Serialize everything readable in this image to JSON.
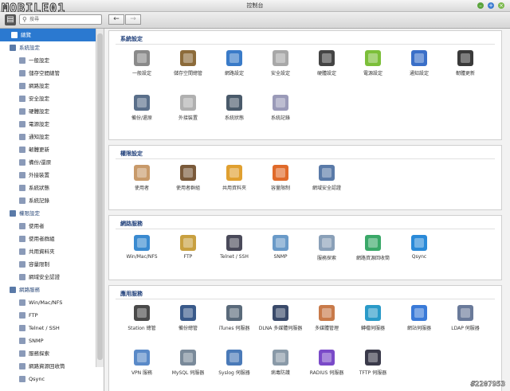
{
  "window": {
    "title": "控制台",
    "logo": "MOBILE01",
    "watermark": "#2207953"
  },
  "toolbar": {
    "search_placeholder": "搜尋",
    "back": "←",
    "forward": "→",
    "menu": "▤"
  },
  "colors": {
    "accent": "#2b79d0",
    "section": "#1f3f7a"
  },
  "sidebar": {
    "overview": "總覽",
    "sections": [
      {
        "label": "系統設定",
        "icon": "gear-icon",
        "items": [
          "一般設定",
          "儲存空間總管",
          "網路設定",
          "安全設定",
          "硬體設定",
          "電源設定",
          "通知設定",
          "韌體更新",
          "備份/還原",
          "外接裝置",
          "系統狀態",
          "系統記錄"
        ]
      },
      {
        "label": "權限設定",
        "icon": "user-icon",
        "items": [
          "使用者",
          "使用者群組",
          "共用資料夾",
          "容量限制",
          "網域安全認證"
        ]
      },
      {
        "label": "網路服務",
        "icon": "globe-icon",
        "items": [
          "Win/Mac/NFS",
          "FTP",
          "Telnet / SSH",
          "SNMP",
          "服務探索",
          "網路資源回收筒",
          "Qsync"
        ]
      }
    ]
  },
  "panels": [
    {
      "title": "系統設定",
      "items": [
        {
          "label": "一般設定",
          "icon": "settings-icon",
          "color": "#8a8a8a"
        },
        {
          "label": "儲存空間總管",
          "icon": "storage-icon",
          "color": "#8c6b3a"
        },
        {
          "label": "網路設定",
          "icon": "network-icon",
          "color": "#3a7bc8"
        },
        {
          "label": "安全設定",
          "icon": "lock-icon",
          "color": "#a8a8a8"
        },
        {
          "label": "硬體設定",
          "icon": "hardware-icon",
          "color": "#444444"
        },
        {
          "label": "電源設定",
          "icon": "power-bulb-icon",
          "color": "#7cbf3a"
        },
        {
          "label": "通知設定",
          "icon": "notification-icon",
          "color": "#3a6fc8"
        },
        {
          "label": "韌體更新",
          "icon": "firmware-icon",
          "color": "#3a3a3a"
        },
        {
          "label": "備份/還原",
          "icon": "backup-icon",
          "color": "#5a6f8a"
        },
        {
          "label": "外接裝置",
          "icon": "external-drive-icon",
          "color": "#b0b0b0"
        },
        {
          "label": "系統狀態",
          "icon": "monitor-icon",
          "color": "#4a5a6a"
        },
        {
          "label": "系統記錄",
          "icon": "log-icon",
          "color": "#9a9ab8"
        }
      ]
    },
    {
      "title": "權限設定",
      "items": [
        {
          "label": "使用者",
          "icon": "user-icon",
          "color": "#c89a6a"
        },
        {
          "label": "使用者群組",
          "icon": "group-icon",
          "color": "#7a5a3a"
        },
        {
          "label": "共用資料夾",
          "icon": "folder-icon",
          "color": "#e0a030"
        },
        {
          "label": "容量限制",
          "icon": "quota-icon",
          "color": "#e06a2a"
        },
        {
          "label": "網域安全認證",
          "icon": "domain-icon",
          "color": "#5a7aa8"
        }
      ]
    },
    {
      "title": "網路服務",
      "items": [
        {
          "label": "Win/Mac/NFS",
          "icon": "win-mac-icon",
          "color": "#3a8ad0"
        },
        {
          "label": "FTP",
          "icon": "ftp-icon",
          "color": "#c8a040"
        },
        {
          "label": "Telnet / SSH",
          "icon": "terminal-icon",
          "color": "#4a4a5a"
        },
        {
          "label": "SNMP",
          "icon": "snmp-icon",
          "color": "#6a9ac8"
        },
        {
          "label": "服務探索",
          "icon": "discovery-icon",
          "color": "#8aa0b8"
        },
        {
          "label": "網路資源回收筒",
          "icon": "recycle-icon",
          "color": "#3aa868"
        },
        {
          "label": "Qsync",
          "icon": "qsync-icon",
          "color": "#2a8ad8"
        }
      ]
    },
    {
      "title": "應用服務",
      "items": [
        {
          "label": "Station 總管",
          "icon": "station-icon",
          "color": "#4a4a4a"
        },
        {
          "label": "備份總管",
          "icon": "backup-manager-icon",
          "color": "#3a5a8a"
        },
        {
          "label": "iTunes 伺服器",
          "icon": "itunes-icon",
          "color": "#5a6a7a"
        },
        {
          "label": "DLNA 多媒體伺服器",
          "icon": "dlna-icon",
          "color": "#3a4a6a"
        },
        {
          "label": "多媒體管理",
          "icon": "multimedia-icon",
          "color": "#c87a4a"
        },
        {
          "label": "轉檔伺服器",
          "icon": "transcode-icon",
          "color": "#2a9ac8"
        },
        {
          "label": "網站伺服器",
          "icon": "web-server-icon",
          "color": "#3a7ad8"
        },
        {
          "label": "LDAP 伺服器",
          "icon": "ldap-icon",
          "color": "#6a7a9a"
        },
        {
          "label": "VPN 服務",
          "icon": "vpn-icon",
          "color": "#5a8ac8"
        },
        {
          "label": "MySQL 伺服器",
          "icon": "mysql-icon",
          "color": "#7a8a9a"
        },
        {
          "label": "Syslog 伺服器",
          "icon": "syslog-icon",
          "color": "#4a7ab8"
        },
        {
          "label": "病毒防護",
          "icon": "antivirus-icon",
          "color": "#8a9aa8"
        },
        {
          "label": "RADIUS 伺服器",
          "icon": "radius-icon",
          "color": "#7a4ac8"
        },
        {
          "label": "TFTP 伺服器",
          "icon": "tftp-icon",
          "color": "#3a3a4a"
        }
      ]
    }
  ]
}
